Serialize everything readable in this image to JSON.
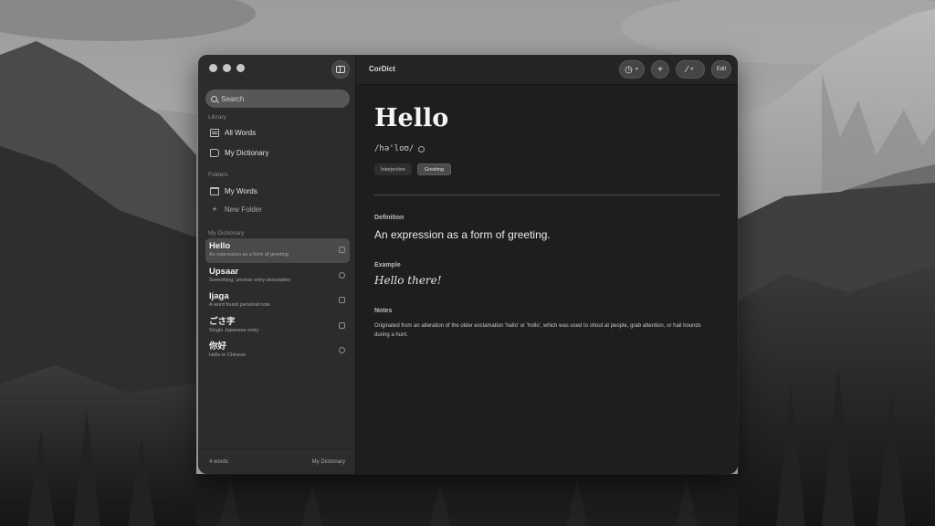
{
  "app": {
    "title": "CorDict"
  },
  "sidebar": {
    "search_placeholder": "Search",
    "library_label": "Library",
    "library_items": [
      {
        "label": "All Words",
        "icon": "list-icon"
      },
      {
        "label": "My Dictionary",
        "icon": "book-icon"
      }
    ],
    "folders_label": "Folders",
    "folder_items": [
      {
        "label": "My Words",
        "icon": "folder-icon"
      },
      {
        "label": "New Folder",
        "icon": "plus-icon"
      }
    ],
    "list_label": "My Dictionary",
    "words": [
      {
        "word": "Hello",
        "desc": "An expression as a form of greeting",
        "selected": true
      },
      {
        "word": "Upsaar",
        "desc": "Something, unclear entry description",
        "selected": false
      },
      {
        "word": "Ijaga",
        "desc": "A word found personal note",
        "selected": false
      },
      {
        "word": "ごさ字",
        "desc": "Single Japanese entry",
        "selected": false
      },
      {
        "word": "你好",
        "desc": "Hello in Chinese",
        "selected": false
      }
    ],
    "footer_left": "4 words",
    "footer_right": "My Dictionary"
  },
  "toolbar": {
    "history_icon": "clock-icon",
    "add_icon": "plus-icon",
    "magic_icon": "wand-icon",
    "edit_label": "Edit"
  },
  "entry": {
    "headword": "Hello",
    "pronunciation": "/hə'loʊ/",
    "tags": [
      "Interjection",
      "Greeting"
    ],
    "definition_label": "Definition",
    "definition": "An expression as a form of greeting.",
    "example_label": "Example",
    "example": "Hello there!",
    "notes_label": "Notes",
    "notes": "Originated from an alteration of the older exclamation 'hallo' or 'hollo', which was used to shout at people, grab attention, or hail hounds during a hunt."
  }
}
